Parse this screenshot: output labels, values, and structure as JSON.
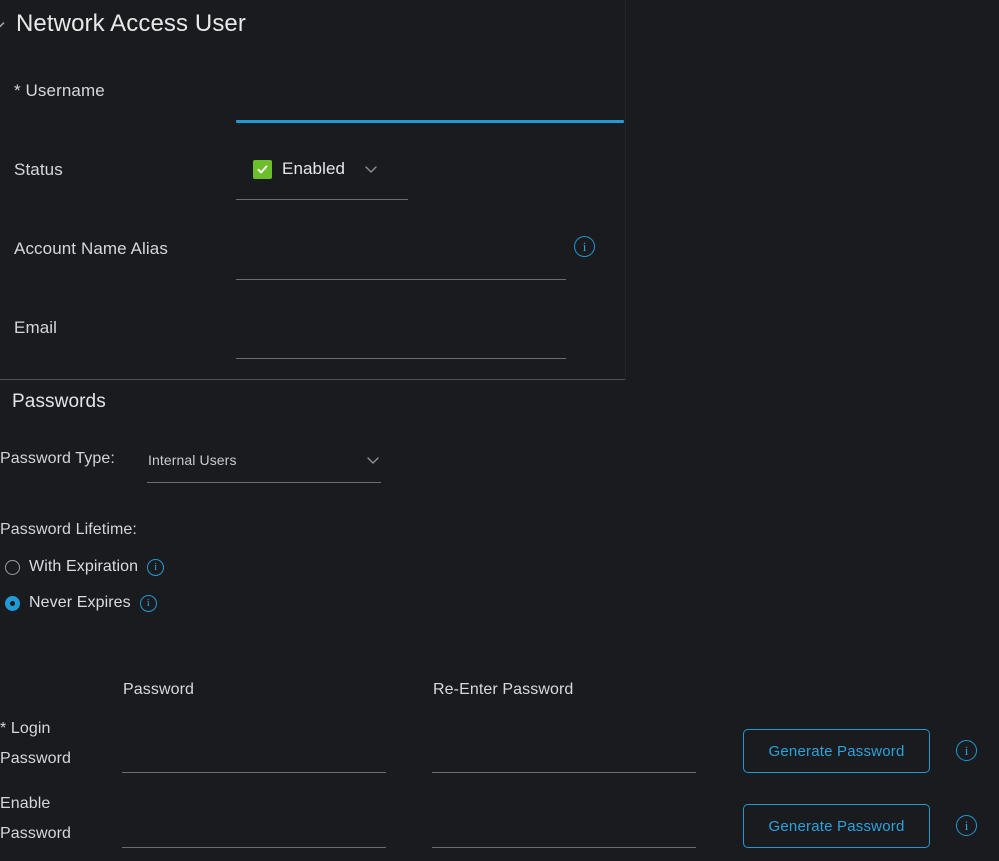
{
  "section": {
    "title": "Network Access User",
    "collapse_icon": "chevron-down-icon"
  },
  "fields": {
    "username": {
      "label": "* Username",
      "value": "",
      "placeholder": ""
    },
    "status": {
      "label": "Status",
      "value": "Enabled",
      "checkbox_icon": "check-icon",
      "dropdown_icon": "chevron-down-icon"
    },
    "account_name_alias": {
      "label": "Account Name Alias",
      "value": "",
      "placeholder": "",
      "info_icon": "info-icon"
    },
    "email": {
      "label": "Email",
      "value": "",
      "placeholder": ""
    }
  },
  "passwords": {
    "heading": "Passwords",
    "password_type": {
      "label": "Password Type:",
      "value": "Internal Users",
      "dropdown_icon": "chevron-down-icon"
    },
    "password_lifetime": {
      "label": "Password Lifetime:",
      "options": [
        {
          "label": "With Expiration",
          "selected": false,
          "info_icon": "info-icon"
        },
        {
          "label": "Never Expires",
          "selected": true,
          "info_icon": "info-icon"
        }
      ]
    },
    "columns": {
      "password": "Password",
      "reenter": "Re-Enter Password"
    },
    "rows": [
      {
        "label_line1": "* Login",
        "label_line2": "Password",
        "password_value": "",
        "reenter_value": "",
        "button_label": "Generate Password",
        "info_icon": "info-icon"
      },
      {
        "label_line1": "Enable",
        "label_line2": "Password",
        "password_value": "",
        "reenter_value": "",
        "button_label": "Generate Password",
        "info_icon": "info-icon"
      }
    ]
  },
  "colors": {
    "background": "#191b1e",
    "accent": "#1f9ad6",
    "accent_text": "#2aa3dd",
    "checkbox_green": "#6cbe2a",
    "text_primary": "#d8dadd",
    "underline": "#6a6e72",
    "divider": "#4d5155"
  }
}
